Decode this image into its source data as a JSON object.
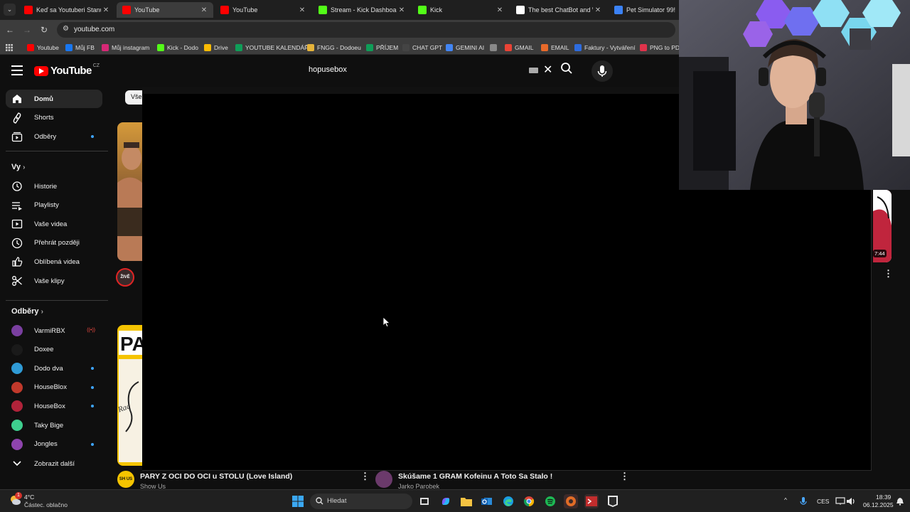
{
  "browser": {
    "tabs": [
      {
        "label": "Keď sa Youtuberi Stanú O",
        "favicon": "youtube-favicon",
        "active": false
      },
      {
        "label": "YouTube",
        "favicon": "youtube-favicon",
        "active": true
      },
      {
        "label": "YouTube",
        "favicon": "youtube-favicon",
        "active": false
      },
      {
        "label": "Stream - Kick Dashboard",
        "favicon": "kick-favicon",
        "active": false
      },
      {
        "label": "Kick",
        "favicon": "kick-favicon",
        "active": false
      },
      {
        "label": "The best ChatBot and Wi",
        "favicon": "chatbot-favicon",
        "active": false
      },
      {
        "label": "Pet Simulator 99!",
        "favicon": "roblox-favicon",
        "active": false
      }
    ],
    "url": "youtube.com",
    "bookmarks": [
      {
        "label": "Youtube",
        "icon": "youtube-icon",
        "color": "#ff0000"
      },
      {
        "label": "Můj FB",
        "icon": "facebook-icon",
        "color": "#1877f2"
      },
      {
        "label": "Můj instagram",
        "icon": "instagram-icon",
        "color": "#d62976"
      },
      {
        "label": "Kick - Dodo",
        "icon": "kick-icon",
        "color": "#53fc18"
      },
      {
        "label": "Drive",
        "icon": "drive-icon",
        "color": "#fbbc04"
      },
      {
        "label": "YOUTUBE KALENDÁŘ",
        "icon": "sheets-icon",
        "color": "#0f9d58"
      },
      {
        "label": "FNGG - Dodoeu",
        "icon": "fngg-icon",
        "color": "#e5b33a"
      },
      {
        "label": "PŘÍJEM",
        "icon": "sheets-icon",
        "color": "#0f9d58"
      },
      {
        "label": "CHAT GPT",
        "icon": "openai-icon",
        "color": "#444444"
      },
      {
        "label": "GEMINI AI",
        "icon": "gemini-icon",
        "color": "#4285f4"
      },
      {
        "label": "",
        "icon": "globe-icon",
        "color": "#888888"
      },
      {
        "label": "GMAIL",
        "icon": "gmail-icon",
        "color": "#ea4335"
      },
      {
        "label": "EMAIL",
        "icon": "email-icon",
        "color": "#e86a2a"
      },
      {
        "label": "Faktury - Vytváření",
        "icon": "invoice-icon",
        "color": "#2d6cdf"
      },
      {
        "label": "PNG to PDF",
        "icon": "pdf-icon",
        "color": "#e0334b"
      }
    ]
  },
  "youtube": {
    "logo_text": "YouTube",
    "country_code": "CZ",
    "search_query": "hopusebox",
    "sidebar": {
      "main": [
        {
          "label": "Domů",
          "icon": "home-icon",
          "active": true
        },
        {
          "label": "Shorts",
          "icon": "shorts-icon",
          "active": false
        },
        {
          "label": "Odběry",
          "icon": "subscriptions-icon",
          "active": false,
          "dot": true
        }
      ],
      "you_heading": "Vy",
      "you": [
        {
          "label": "Historie",
          "icon": "history-icon"
        },
        {
          "label": "Playlisty",
          "icon": "playlists-icon"
        },
        {
          "label": "Vaše videa",
          "icon": "your-videos-icon"
        },
        {
          "label": "Přehrát později",
          "icon": "watch-later-icon"
        },
        {
          "label": "Oblíbená videa",
          "icon": "liked-icon"
        },
        {
          "label": "Vaše klipy",
          "icon": "clips-icon"
        }
      ],
      "subs_heading": "Odběry",
      "subscriptions": [
        {
          "label": "VarmiRBX",
          "color": "#7a3fa0",
          "status": "live"
        },
        {
          "label": "Doxee",
          "color": "#1a1a1a",
          "status": ""
        },
        {
          "label": "Dodo dva",
          "color": "#2f9bd6",
          "status": "dot"
        },
        {
          "label": "HouseBlox",
          "color": "#c0392b",
          "status": "dot"
        },
        {
          "label": "HouseBox",
          "color": "#b0233a",
          "status": "dot"
        },
        {
          "label": "Taky Bige",
          "color": "#3ecf8e",
          "status": ""
        },
        {
          "label": "Jongles",
          "color": "#8e44ad",
          "status": "dot"
        }
      ],
      "show_more": "Zobrazit další"
    },
    "chip_first": "Vše",
    "live_badge": "ŽIVĚ",
    "peek_duration": "7:44",
    "videos": [
      {
        "title": "PARY Z OCI DO OCI u STOLU (Love Island)",
        "channel": "Show Us",
        "avatar_text": "SH US",
        "avatar_color": "#f5c400"
      },
      {
        "title": "Skúšame 1 GRAM Kofeinu A Toto Sa Stalo !",
        "channel": "Jarko Parobek",
        "avatar_text": "",
        "avatar_color": "#6b3a6b"
      }
    ]
  },
  "taskbar": {
    "weather_temp": "4°C",
    "weather_desc": "Částec. oblačno",
    "weather_badge": "1",
    "search_placeholder": "Hledat",
    "language": "CES",
    "time": "18:39",
    "date": "06.12.2025"
  },
  "colors": {
    "yt_bg": "#0f0f0f",
    "accent_red": "#ff0000",
    "dot_blue": "#3ea6ff"
  }
}
